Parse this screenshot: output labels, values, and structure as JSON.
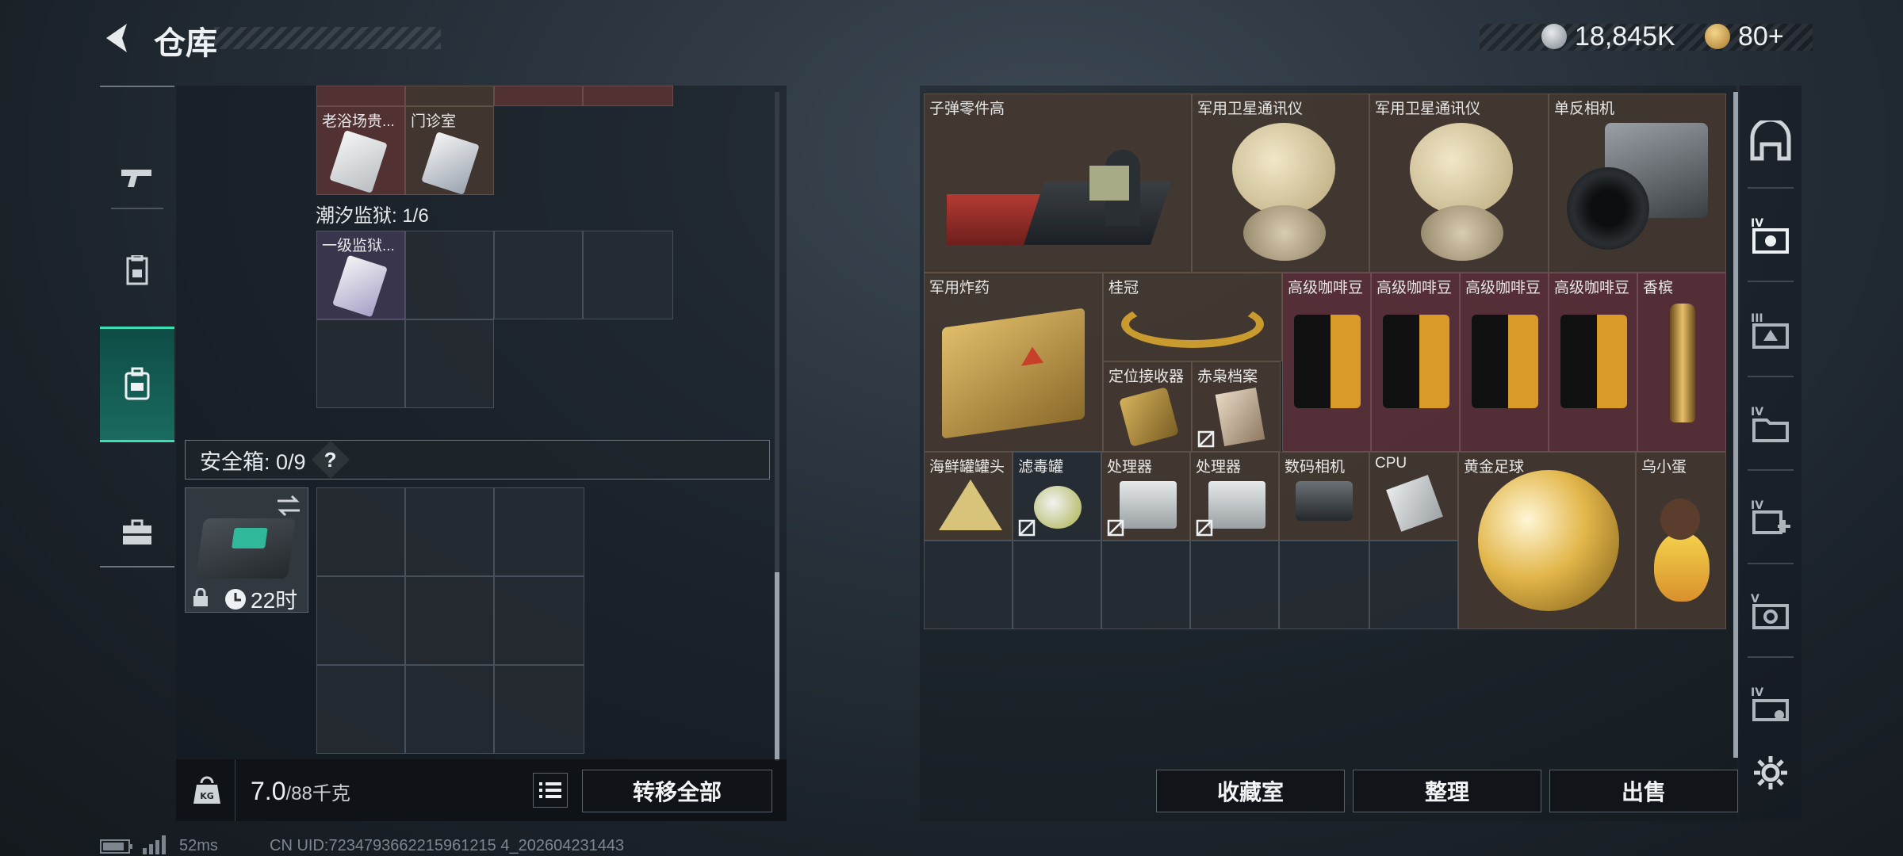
{
  "header": {
    "title": "仓库",
    "currency_primary": "18,845K",
    "currency_secondary": "80+"
  },
  "left_panel": {
    "top_items": [
      {
        "label": "老浴场贵..."
      },
      {
        "label": "门诊室"
      }
    ],
    "prison_label": "潮汐监狱: 1/6",
    "prison_items": [
      {
        "label": "一级监狱..."
      }
    ],
    "safe_box": {
      "label": "安全箱: 0/9",
      "help": "?",
      "timer": "22时"
    },
    "weight": {
      "current": "7.0",
      "max": "/88千克"
    },
    "transfer_all_label": "转移全部"
  },
  "grid_items": [
    {
      "label": "子弹零件高"
    },
    {
      "label": "军用卫星通讯仪"
    },
    {
      "label": "军用卫星通讯仪"
    },
    {
      "label": "单反相机"
    },
    {
      "label": "军用炸药"
    },
    {
      "label": "桂冠"
    },
    {
      "label": "高级咖啡豆"
    },
    {
      "label": "高级咖啡豆"
    },
    {
      "label": "高级咖啡豆"
    },
    {
      "label": "高级咖啡豆"
    },
    {
      "label": "香槟"
    },
    {
      "label": "定位接收器"
    },
    {
      "label": "赤枭档案"
    },
    {
      "label": "海鲜罐罐头"
    },
    {
      "label": "滤毒罐"
    },
    {
      "label": "处理器"
    },
    {
      "label": "处理器"
    },
    {
      "label": "数码相机"
    },
    {
      "label": "CPU"
    },
    {
      "label": "黄金足球"
    },
    {
      "label": "乌小蛋"
    }
  ],
  "bottom_buttons": {
    "collection": "收藏室",
    "sort": "整理",
    "sell": "出售"
  },
  "status_bar": {
    "ping": "52ms",
    "uid": "CN UID:7234793662215961215 4_202604231443"
  },
  "colors": {
    "accent": "#39e0b4",
    "rarity_red": "#5c3434",
    "rarity_brown": "#463a30",
    "rarity_purple": "#3e3852"
  }
}
